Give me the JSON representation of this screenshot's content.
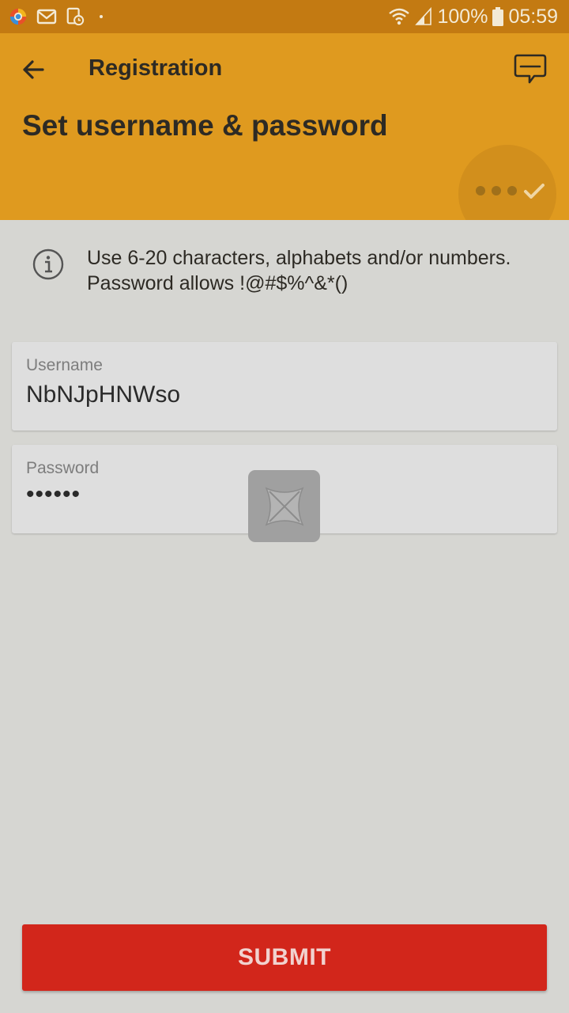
{
  "status_bar": {
    "battery_text": "100%",
    "time": "05:59",
    "icons": [
      "browser-app-icon",
      "gmail-icon",
      "calendar-clock-icon",
      "wifi-icon",
      "signal-icon",
      "battery-icon"
    ]
  },
  "header": {
    "title": "Registration",
    "page_title": "Set username & password",
    "progress_steps": 4,
    "current_step": 4,
    "background_color": "#df9a1f"
  },
  "info": {
    "text": "Use 6-20 characters, alphabets and/or numbers. Password allows !@#$%^&*()"
  },
  "form": {
    "username": {
      "label": "Username",
      "value": "NbNJpHNWso"
    },
    "password": {
      "label": "Password",
      "value": "••••••"
    }
  },
  "submit": {
    "label": "SUBMIT",
    "color": "#d2261b"
  }
}
